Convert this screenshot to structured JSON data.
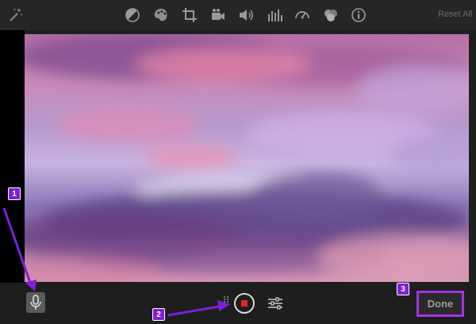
{
  "toolbar": {
    "icons": [
      "magic-wand-icon",
      "color-balance-icon",
      "color-palette-icon",
      "crop-icon",
      "video-camera-icon",
      "volume-icon",
      "equalizer-icon",
      "speedometer-icon",
      "filter-circles-icon",
      "info-icon"
    ],
    "reset_all_label": "Reset All"
  },
  "preview": {
    "image": "pink-purple sunset clouds"
  },
  "bottom_bar": {
    "mic_icon": "microphone-icon",
    "record_icon": "record-stop-icon",
    "settings_icon": "sliders-icon",
    "done_label": "Done"
  },
  "annotations": {
    "badges": [
      "1",
      "2",
      "3"
    ],
    "highlight_color": "#a233e8",
    "badge_color": "#7e1fd6"
  }
}
